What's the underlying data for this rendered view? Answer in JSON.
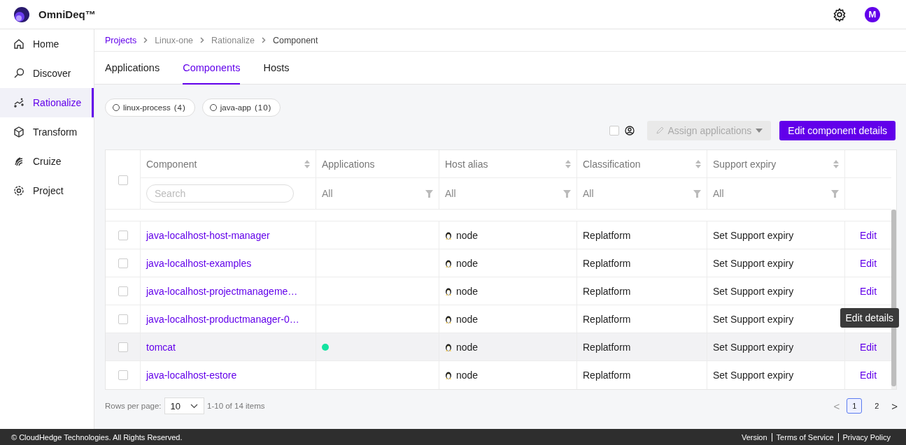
{
  "app": {
    "name": "OmniDeq™",
    "avatar": "M"
  },
  "sidebar": {
    "items": [
      {
        "label": "Home",
        "selected": false
      },
      {
        "label": "Discover",
        "selected": false
      },
      {
        "label": "Rationalize",
        "selected": true
      },
      {
        "label": "Transform",
        "selected": false
      },
      {
        "label": "Cruize",
        "selected": false
      },
      {
        "label": "Project",
        "selected": false
      }
    ]
  },
  "breadcrumb": [
    {
      "label": "Projects",
      "link": true
    },
    {
      "label": "Linux-one",
      "link": false
    },
    {
      "label": "Rationalize",
      "link": false
    },
    {
      "label": "Component",
      "link": false
    }
  ],
  "tabs": [
    {
      "label": "Applications",
      "selected": false
    },
    {
      "label": "Components",
      "selected": true
    },
    {
      "label": "Hosts",
      "selected": false
    }
  ],
  "filter_chips": [
    {
      "label": "linux-process",
      "count": "(4)",
      "selected": false
    },
    {
      "label": "java-app",
      "count": "(10)",
      "selected": false
    }
  ],
  "toolbar": {
    "select_all_checked": false,
    "assign_button": "Assign applications",
    "assign_disabled": true,
    "edit_button": "Edit component details"
  },
  "table": {
    "columns": [
      {
        "label": "Component",
        "sortable": true,
        "kind": "search",
        "placeholder": "Search"
      },
      {
        "label": "Applications",
        "sortable": false,
        "kind": "select",
        "value": "All"
      },
      {
        "label": "Host alias",
        "sortable": true,
        "kind": "select",
        "value": "All"
      },
      {
        "label": "Classification",
        "sortable": true,
        "kind": "select",
        "value": "All"
      },
      {
        "label": "Support expiry",
        "sortable": true,
        "kind": "select",
        "value": "All"
      }
    ],
    "header_checked": false,
    "rows": [
      {
        "component": "java-localhost-host-manager",
        "host": "node",
        "classification": "Replatform",
        "support": "Set Support expiry",
        "edit": "Edit",
        "checked": false,
        "highlighted": false
      },
      {
        "component": "java-localhost-examples",
        "host": "node",
        "classification": "Replatform",
        "support": "Set Support expiry",
        "edit": "Edit",
        "checked": false,
        "highlighted": false
      },
      {
        "component": "java-localhost-projectmanageme…",
        "host": "node",
        "classification": "Replatform",
        "support": "Set Support expiry",
        "edit": "Edit",
        "checked": false,
        "highlighted": false
      },
      {
        "component": "java-localhost-productmanager-0…",
        "host": "node",
        "classification": "Replatform",
        "support": "Set Support expiry",
        "checked": false,
        "highlighted": false
      },
      {
        "component": "tomcat",
        "color": "#14e3a0",
        "host": "node",
        "classification": "Replatform",
        "support": "Set Support expiry",
        "edit": "Edit",
        "checked": false,
        "highlighted": true
      },
      {
        "component": "java-localhost-estore",
        "host": "node",
        "classification": "Replatform",
        "support": "Set Support expiry",
        "edit": "Edit",
        "checked": false,
        "highlighted": false
      }
    ],
    "tooltip": "Edit details"
  },
  "pagination": {
    "rows_label": "Rows per page:",
    "rows_value": "10",
    "range": "1-10 of 14 items",
    "prev": "<",
    "pages": [
      {
        "label": "1",
        "selected": true
      },
      {
        "label": "2",
        "selected": false
      }
    ],
    "next": ">"
  },
  "footer": {
    "copyright": "© CloudHedge Technologies. All Rights Reserved.",
    "links": [
      "Version",
      "Terms of Service",
      "Privacy Policy"
    ]
  }
}
